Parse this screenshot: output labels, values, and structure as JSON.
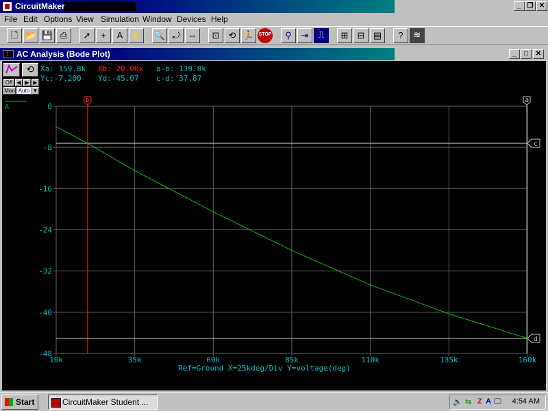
{
  "app": {
    "title": "CircuitMaker",
    "caption_buttons": [
      "_",
      "❐",
      "✕"
    ]
  },
  "menu": [
    "File",
    "Edit",
    "Options",
    "View",
    "Simulation",
    "Window",
    "Devices",
    "Help"
  ],
  "toolbar": {
    "icons": [
      "new-icon",
      "open-icon",
      "save-icon",
      "print-icon",
      "arrow-icon",
      "wire-icon",
      "text-icon",
      "probe-icon",
      "zoom-icon",
      "rotate-icon",
      "mirror-icon",
      "step-icon",
      "reset-icon",
      "run-icon",
      "stop-icon",
      "trace-icon",
      "digital-icon",
      "analog-icon",
      "waveform-icon",
      "scope-icon",
      "help-icon",
      "logic-icon"
    ]
  },
  "window": {
    "title": "AC Analysis (Bode Plot)",
    "caption_buttons": [
      "_",
      "□",
      "✕"
    ]
  },
  "readouts": {
    "xa": "Xa: 159.8k",
    "xb": "Xb: 20.00k",
    "ab": "a-b: 139.8k",
    "yc": "Yc:-7.200",
    "yd": "Yd:-45.07",
    "cd": "c-d: 37.87"
  },
  "controls": {
    "off": "Off",
    "man": "Man",
    "auto": "Auto"
  },
  "chart_data": {
    "type": "line",
    "xlabel": "Ref=Ground  X=25kdeg/Div Y=voltage(deg)",
    "xlim": [
      10000,
      160000
    ],
    "ylim": [
      -48,
      0
    ],
    "x_ticks": [
      "10k",
      "35k",
      "60k",
      "85k",
      "110k",
      "135k",
      "160k"
    ],
    "y_ticks": [
      "0",
      "-8",
      "-16",
      "-24",
      "-32",
      "-40",
      "-48"
    ],
    "x_tick_values": [
      10000,
      35000,
      60000,
      85000,
      110000,
      135000,
      160000
    ],
    "y_tick_values": [
      0,
      -8,
      -16,
      -24,
      -32,
      -40,
      -48
    ],
    "grid": true,
    "series": [
      {
        "name": "A",
        "color": "#00c000",
        "x": [
          10000,
          20000,
          35000,
          45000,
          60000,
          85000,
          110000,
          135000,
          160000
        ],
        "y": [
          -4.0,
          -7.2,
          -12.5,
          -15.7,
          -20.5,
          -28.0,
          -34.7,
          -40.3,
          -45.07
        ]
      }
    ],
    "cursors": [
      {
        "label": "b",
        "axis": "x",
        "value": 20000,
        "color": "#ff2020"
      },
      {
        "label": "a",
        "axis": "x",
        "value": 159800,
        "color": "#c0c0c0"
      },
      {
        "label": "c",
        "axis": "y",
        "value": -7.2,
        "color": "#c0c0c0"
      },
      {
        "label": "d",
        "axis": "y",
        "value": -45.07,
        "color": "#c0c0c0"
      }
    ]
  },
  "taskbar": {
    "start": "Start",
    "task": "CircuitMaker Student ...",
    "clock": "4:54 AM"
  }
}
